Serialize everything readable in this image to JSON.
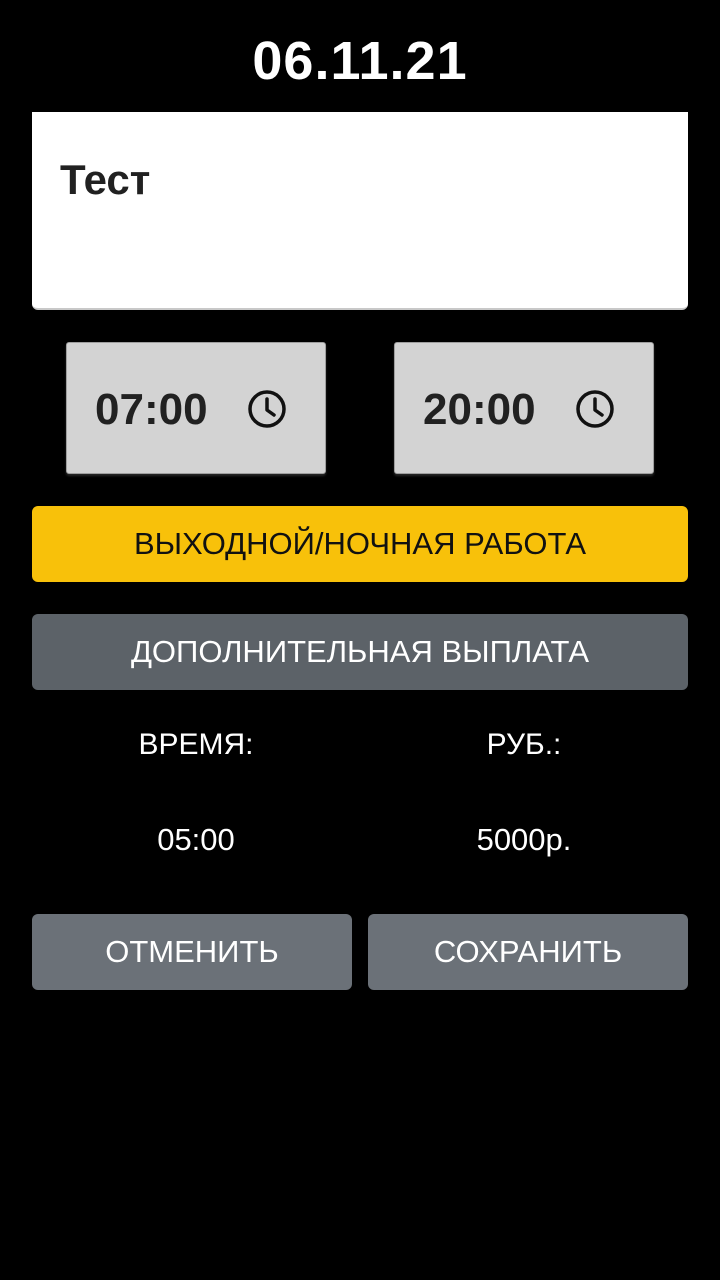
{
  "header": {
    "date": "06.11.21"
  },
  "note": {
    "text": "Тест"
  },
  "time_start": {
    "value": "07:00",
    "icon": "clock-icon"
  },
  "time_end": {
    "value": "20:00",
    "icon": "clock-icon"
  },
  "buttons": {
    "weekend": "ВЫХОДНОЙ/НОЧНАЯ РАБОТА",
    "extra_payment": "ДОПОЛНИТЕЛЬНАЯ ВЫПЛАТА",
    "cancel": "ОТМЕНИТЬ",
    "save": "СОХРАНИТЬ"
  },
  "summary": {
    "time_label": "ВРЕМЯ:",
    "rub_label": "РУБ.:",
    "time_value": "05:00",
    "rub_value": "5000р."
  },
  "colors": {
    "background": "#000000",
    "accent": "#f8c10a",
    "button_dark": "#5c6268",
    "button_gray": "#6b7178",
    "picker_bg": "#d3d3d3"
  }
}
